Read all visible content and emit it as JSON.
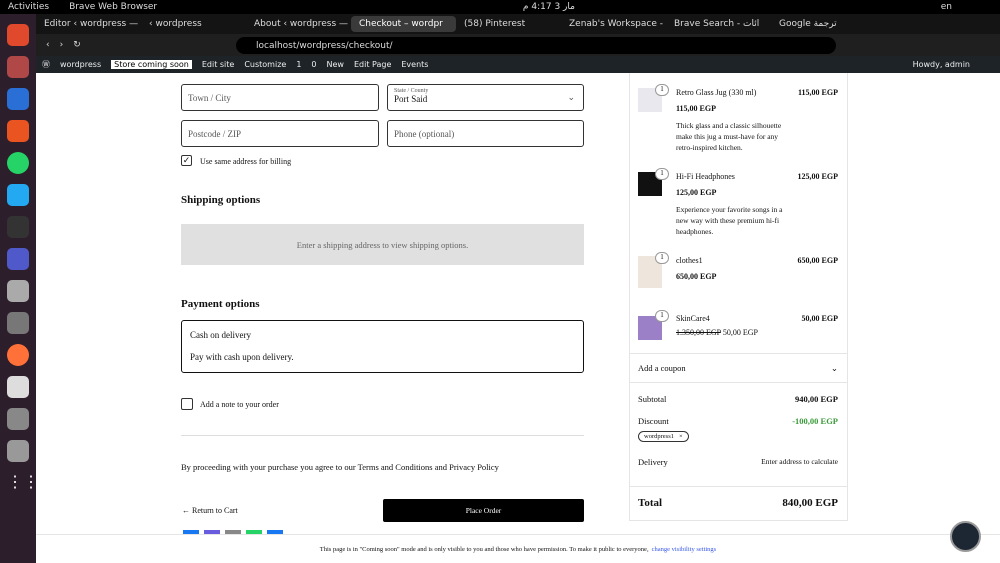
{
  "system": {
    "activities": "Activities",
    "app": "Brave Web Browser",
    "clock": "مار 3  4:17 م",
    "lang": "en"
  },
  "tabs": [
    {
      "label": "Editor ‹ wordpress — W"
    },
    {
      "label": "‹ wordpress"
    },
    {
      "label": "About ‹ wordpress — W"
    },
    {
      "label": "Checkout – wordpr",
      "active": true
    },
    {
      "label": "(58) Pinterest"
    },
    {
      "label": "Zenab's Workspace - S"
    },
    {
      "label": "Brave Search - ائات"
    },
    {
      "label": "Google ترجمة"
    }
  ],
  "address": {
    "url": "localhost/wordpress/checkout/"
  },
  "wpbar": {
    "site": "wordpress",
    "store_badge": "Store coming soon",
    "edit_site": "Edit site",
    "customize": "Customize",
    "updates": "1",
    "comments": "0",
    "new": "New",
    "edit_page": "Edit Page",
    "events": "Events",
    "howdy": "Howdy, admin"
  },
  "form": {
    "city_placeholder": "Town / City",
    "state_label": "State / County",
    "state_value": "Port Said",
    "postcode_placeholder": "Postcode / ZIP",
    "phone_placeholder": "Phone (optional)",
    "same_billing": "Use same address for billing",
    "shipping_title": "Shipping options",
    "shipping_msg": "Enter a shipping address to view shipping options.",
    "payment_title": "Payment options",
    "payment_method": "Cash on delivery",
    "payment_desc": "Pay with cash upon delivery.",
    "note_label": "Add a note to your order",
    "terms": "By proceeding with your purchase you agree to our Terms and Conditions and Privacy Policy",
    "return": "Return to Cart",
    "place_order": "Place Order"
  },
  "summary": {
    "items": [
      {
        "qty": "1",
        "name": "Retro Glass Jug (330 ml)",
        "total": "115,00 EGP",
        "price": "115,00 EGP",
        "desc": "Thick glass and a classic silhouette make this jug a must-have for any retro-inspired kitchen."
      },
      {
        "qty": "1",
        "name": "Hi-Fi Headphones",
        "total": "125,00 EGP",
        "price": "125,00 EGP",
        "desc": "Experience your favorite songs in a new way with these premium hi-fi headphones."
      },
      {
        "qty": "1",
        "name": "clothes1",
        "total": "650,00 EGP",
        "price": "650,00 EGP"
      },
      {
        "qty": "1",
        "name": "SkinCare4",
        "total": "50,00 EGP",
        "old_price": "1.350,00 EGP",
        "price": "50,00 EGP"
      }
    ],
    "coupon": "Add a coupon",
    "subtotal_label": "Subtotal",
    "subtotal": "940,00 EGP",
    "discount_label": "Discount",
    "discount": "-100,00 EGP",
    "coupon_code": "wordpress1",
    "delivery_label": "Delivery",
    "delivery": "Enter address to calculate",
    "total_label": "Total",
    "total": "840,00 EGP"
  },
  "notice": {
    "text": "This page is in \"Coming soon\" mode and is only visible to you and those who have permission. To make it public to everyone,",
    "link": "change visibility settings"
  }
}
